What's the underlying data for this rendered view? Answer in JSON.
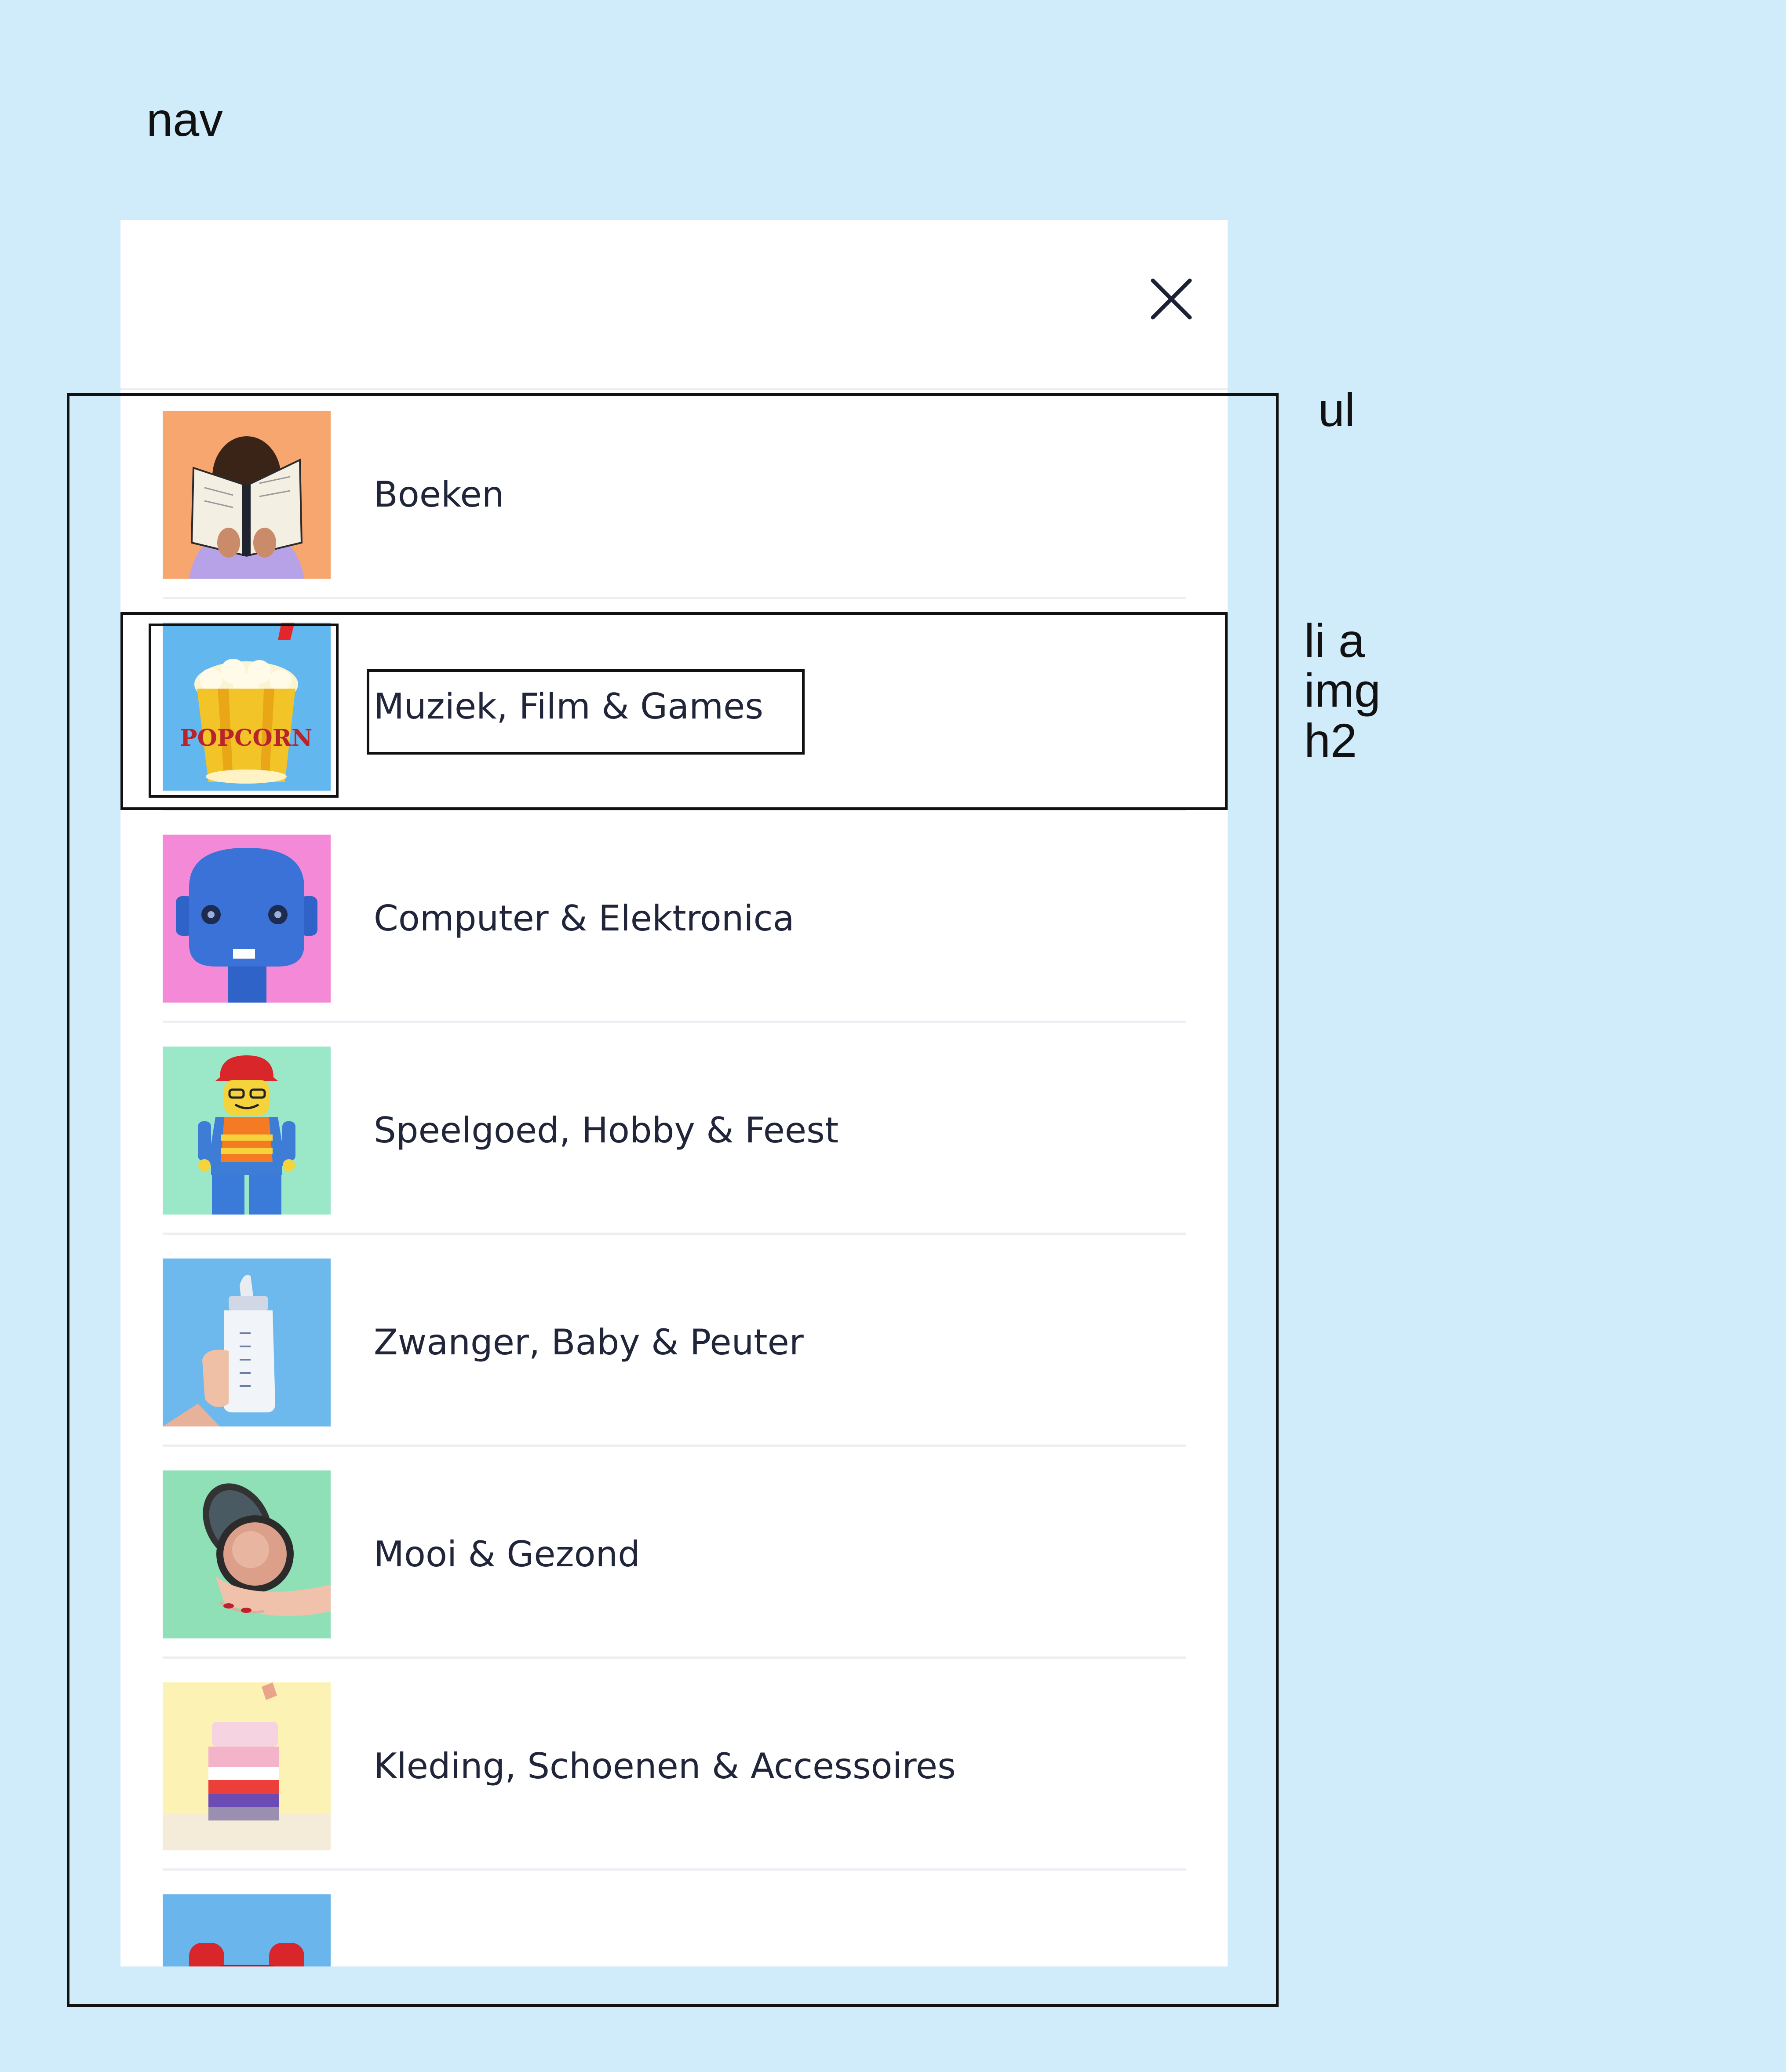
{
  "annotations": {
    "nav": "nav",
    "ul": "ul",
    "li_a": "li a",
    "img": "img",
    "h2": "h2"
  },
  "menu": {
    "close_icon": "close-icon",
    "categories": [
      {
        "title": "Boeken",
        "icon": "book-reading-photo",
        "bg": "#f6a66e"
      },
      {
        "title": "Muziek, Film & Games",
        "icon": "popcorn-bucket-photo",
        "bg": "#62b7ee"
      },
      {
        "title": "Computer & Elektronica",
        "icon": "robot-head-photo",
        "bg": "#f48ad7"
      },
      {
        "title": "Speelgoed, Hobby & Feest",
        "icon": "toy-minifigure-photo",
        "bg": "#9be8c8"
      },
      {
        "title": "Zwanger, Baby & Peuter",
        "icon": "baby-bottle-photo",
        "bg": "#6db8ec"
      },
      {
        "title": "Mooi & Gezond",
        "icon": "compact-powder-photo",
        "bg": "#8fe0b7"
      },
      {
        "title": "Kleding, Schoenen & Accessoires",
        "icon": "folded-clothes-photo",
        "bg": "#fbf2b4"
      },
      {
        "title": "",
        "icon": "dumbbell-photo",
        "bg": "#6ab5ec"
      }
    ]
  }
}
